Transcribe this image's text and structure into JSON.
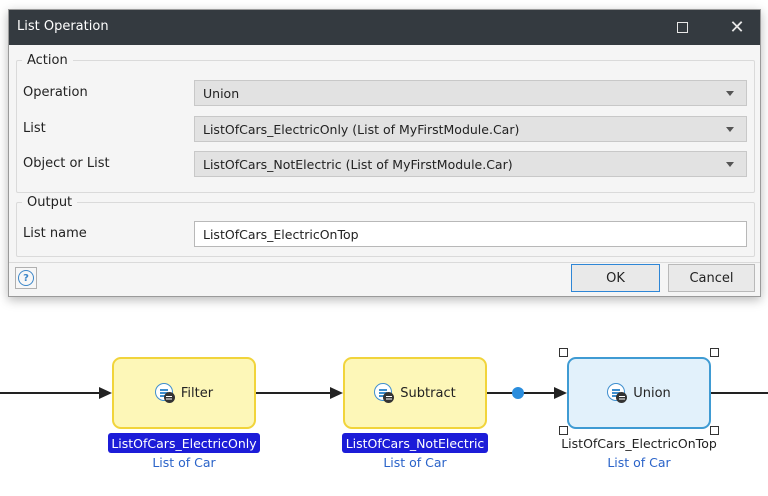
{
  "dialog": {
    "title": "List Operation",
    "action_group": {
      "legend": "Action",
      "operation": {
        "label": "Operation",
        "value": "Union"
      },
      "list": {
        "label": "List",
        "value": "ListOfCars_ElectricOnly (List of MyFirstModule.Car)"
      },
      "object_or_list": {
        "label": "Object or List",
        "value": "ListOfCars_NotElectric (List of MyFirstModule.Car)"
      }
    },
    "output_group": {
      "legend": "Output",
      "list_name": {
        "label": "List name",
        "value": "ListOfCars_ElectricOnTop"
      }
    },
    "help_glyph": "?",
    "ok_label": "OK",
    "cancel_label": "Cancel",
    "close_glyph": "✕"
  },
  "flow": {
    "activities": [
      {
        "label": "Filter",
        "icon": "list-operation-icon",
        "var_name": "ListOfCars_ElectricOnly",
        "var_type": "List of Car"
      },
      {
        "label": "Subtract",
        "icon": "list-operation-icon",
        "var_name": "ListOfCars_NotElectric",
        "var_type": "List of Car"
      },
      {
        "label": "Union",
        "icon": "list-operation-icon",
        "var_name": "ListOfCars_ElectricOnTop",
        "var_type": "List of Car"
      }
    ]
  },
  "colors": {
    "titlebar": "#343a40",
    "activity_fill": "#fdf7b8",
    "activity_border": "#f1d43b",
    "selected_border": "#3f9bd3",
    "highlight_label": "#1c1cd8",
    "link_text": "#2a63c9"
  }
}
